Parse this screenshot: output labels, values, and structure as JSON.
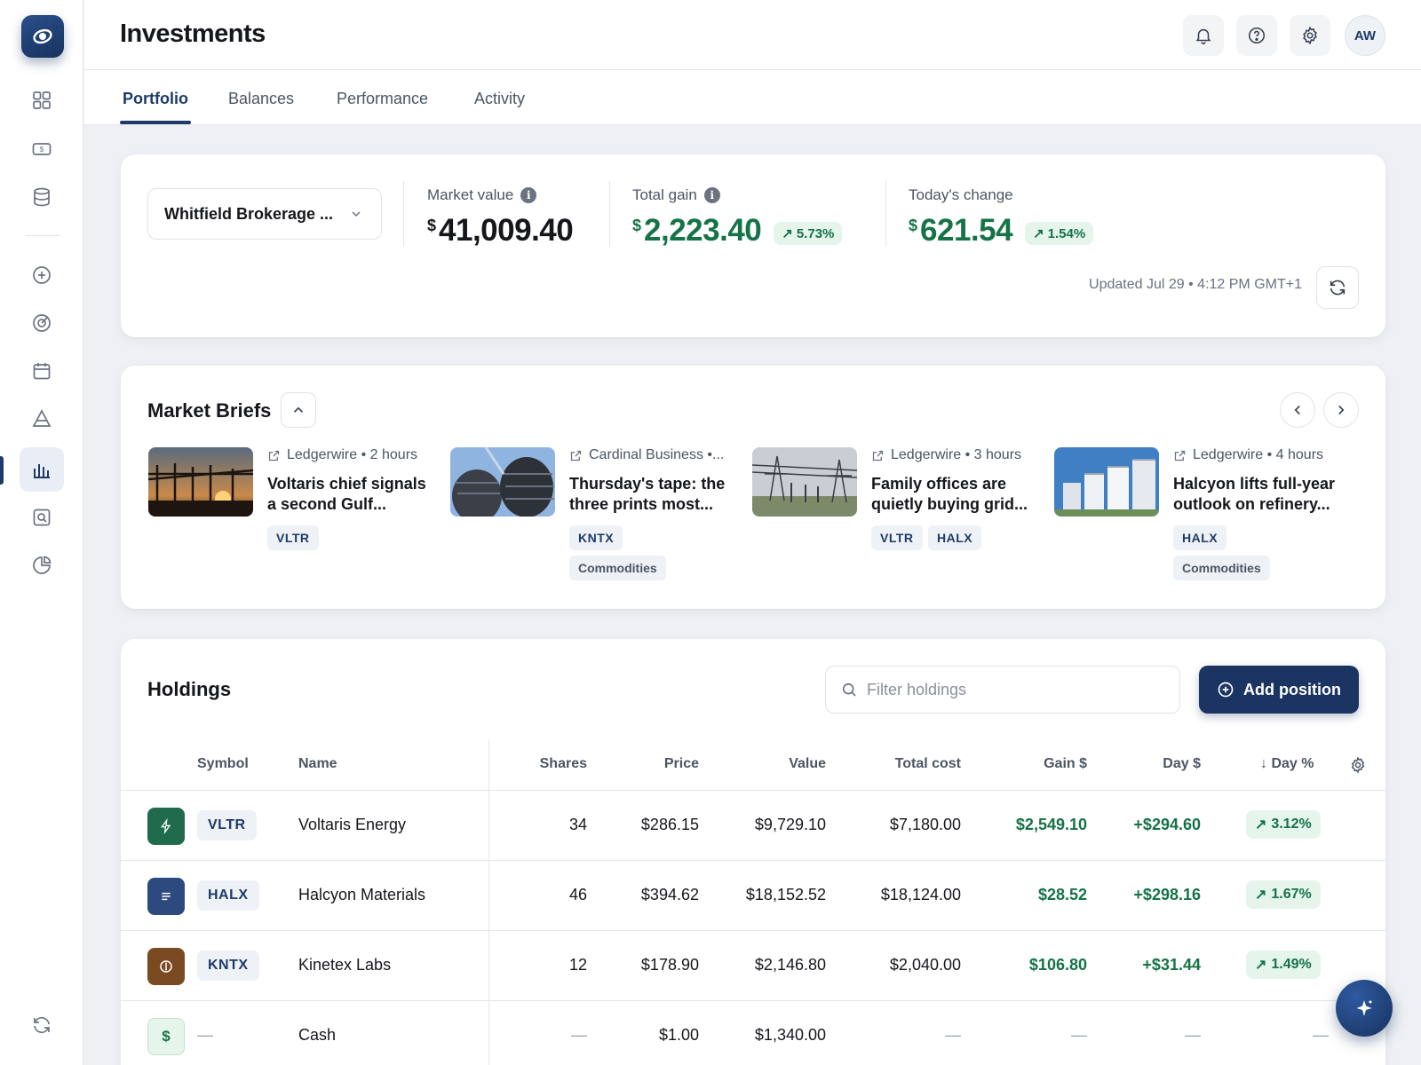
{
  "header": {
    "title": "Investments",
    "avatar_initials": "AW",
    "icons": [
      "bell-icon",
      "help-icon",
      "gear-icon"
    ]
  },
  "tabs": [
    {
      "label": "Portfolio",
      "active": true
    },
    {
      "label": "Balances",
      "active": false
    },
    {
      "label": "Performance",
      "active": false
    },
    {
      "label": "Activity",
      "active": false
    }
  ],
  "sidebar": {
    "items": [
      "dashboard-icon",
      "cash-icon",
      "database-icon",
      "add-circle-icon",
      "target-icon",
      "calendar-icon",
      "triangle-icon",
      "bar-chart-icon",
      "search-doc-icon",
      "pie-chart-icon",
      "sync-icon"
    ],
    "active": "bar-chart-icon"
  },
  "summary": {
    "account": "Whitfield Brokerage ...",
    "market_value": {
      "label": "Market value",
      "currency": "$",
      "value": "41,009.40"
    },
    "total_gain": {
      "label": "Total gain",
      "currency": "$",
      "value": "2,223.40",
      "pct": "5.73%"
    },
    "todays_change": {
      "label": "Today's change",
      "currency": "$",
      "value": "621.54",
      "pct": "1.54%"
    },
    "updated": "Updated Jul 29 • 4:12 PM GMT+1"
  },
  "briefs": {
    "title": "Market Briefs",
    "items": [
      {
        "source": "Ledgerwire • 2 hours",
        "headline": "Voltaris chief signals a second Gulf...",
        "tags": [
          "VLTR"
        ],
        "topics": []
      },
      {
        "source": "Cardinal Business •...",
        "headline": "Thursday's tape: the three prints most...",
        "tags": [
          "KNTX"
        ],
        "topics": [
          "Commodities"
        ]
      },
      {
        "source": "Ledgerwire • 3 hours",
        "headline": "Family offices are quietly buying grid...",
        "tags": [
          "VLTR",
          "HALX"
        ],
        "topics": []
      },
      {
        "source": "Ledgerwire • 4 hours",
        "headline": "Halcyon lifts full-year outlook on refinery...",
        "tags": [
          "HALX"
        ],
        "topics": [
          "Commodities"
        ]
      }
    ]
  },
  "holdings": {
    "title": "Holdings",
    "filter_placeholder": "Filter holdings",
    "add_label": "Add position",
    "columns": {
      "symbol": "Symbol",
      "name": "Name",
      "shares": "Shares",
      "price": "Price",
      "value": "Value",
      "total_cost": "Total cost",
      "gain": "Gain $",
      "day": "Day $",
      "day_pct": "Day %"
    },
    "rows": [
      {
        "symbol": "VLTR",
        "name": "Voltaris Energy",
        "shares": "34",
        "price": "$286.15",
        "value": "$9,729.10",
        "total_cost": "$7,180.00",
        "gain": "$2,549.10",
        "day": "+$294.60",
        "day_pct": "3.12%",
        "icon_color": "#1f6b4b",
        "icon": "bolt-icon"
      },
      {
        "symbol": "HALX",
        "name": "Halcyon Materials",
        "shares": "46",
        "price": "$394.62",
        "value": "$18,152.52",
        "total_cost": "$18,124.00",
        "gain": "$28.52",
        "day": "+$298.16",
        "day_pct": "1.67%",
        "icon_color": "#2c4a7e",
        "icon": "lines-icon"
      },
      {
        "symbol": "KNTX",
        "name": "Kinetex Labs",
        "shares": "12",
        "price": "$178.90",
        "value": "$2,146.80",
        "total_cost": "$2,040.00",
        "gain": "$106.80",
        "day": "+$31.44",
        "day_pct": "1.49%",
        "icon_color": "#7a4a22",
        "icon": "circle-line-icon"
      },
      {
        "symbol": "—",
        "name": "Cash",
        "shares": "—",
        "price": "$1.00",
        "value": "$1,340.00",
        "total_cost": "—",
        "gain": "—",
        "day": "—",
        "day_pct": "—",
        "icon_color": "#e5f5ec",
        "icon": "dollar-icon"
      }
    ]
  },
  "colors": {
    "accent": "#1b3461",
    "positive": "#157347"
  }
}
